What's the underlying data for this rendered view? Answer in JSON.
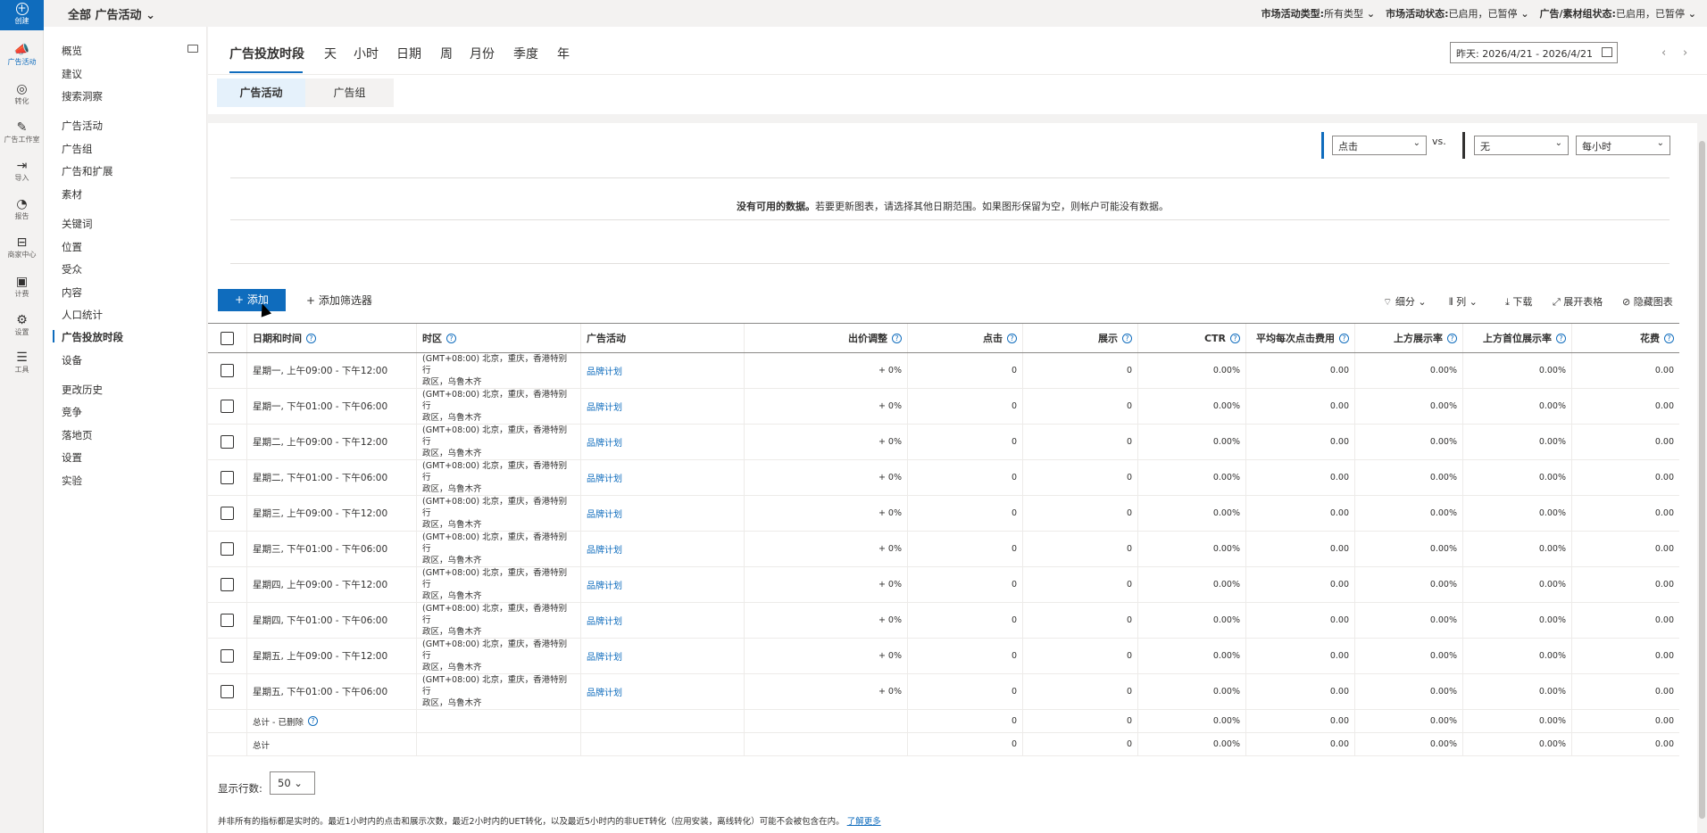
{
  "rail": {
    "create": "创建",
    "items": [
      {
        "label": "广告活动",
        "icon": "megaphone-icon",
        "glyph": "📣"
      },
      {
        "label": "转化",
        "icon": "target-icon",
        "glyph": "◎"
      },
      {
        "label": "广告工作室",
        "icon": "image-edit-icon",
        "glyph": "✎"
      },
      {
        "label": "导入",
        "icon": "import-icon",
        "glyph": "⇥"
      },
      {
        "label": "报告",
        "icon": "report-icon",
        "glyph": "◔"
      },
      {
        "label": "商家中心",
        "icon": "shopping-bag-icon",
        "glyph": "⊟"
      },
      {
        "label": "计费",
        "icon": "wallet-icon",
        "glyph": "▣"
      },
      {
        "label": "设置",
        "icon": "gear-icon",
        "glyph": "⚙"
      },
      {
        "label": "工具",
        "icon": "tools-icon",
        "glyph": "☰"
      }
    ]
  },
  "nav": {
    "items": [
      "概览",
      "建议",
      "搜索洞察",
      "广告活动",
      "广告组",
      "广告和扩展",
      "素材",
      "关键词",
      "位置",
      "受众",
      "内容",
      "人口统计",
      "广告投放时段",
      "设备",
      "更改历史",
      "竞争",
      "落地页",
      "设置",
      "实验"
    ]
  },
  "topbar": {
    "scope": "全部 广告活动",
    "filter1_label": "市场活动类型:",
    "filter1_value": "所有类型",
    "filter2_label": "市场活动状态:",
    "filter2_value": "已启用，已暂停",
    "filter3_label": "广告/素材组状态:",
    "filter3_value": "已启用，已暂停"
  },
  "time_tabs": [
    "广告投放时段",
    "天",
    "小时",
    "日期",
    "周",
    "月份",
    "季度",
    "年"
  ],
  "date_range": "昨天: 2026/4/21 - 2026/4/21",
  "sub_tabs": [
    "广告活动",
    "广告组"
  ],
  "chart": {
    "metric1": "点击",
    "vs": "vs.",
    "metric2": "无",
    "granularity": "每小时",
    "nodata_bold": "没有可用的数据。",
    "nodata_rest": "若要更新图表，请选择其他日期范围。如果图形保留为空，则帐户可能没有数据。"
  },
  "toolbar": {
    "add": "添加",
    "add_filter": "添加筛选器",
    "segment": "细分",
    "columns": "列",
    "download": "下载",
    "expand": "展开表格",
    "hide_chart": "隐藏图表"
  },
  "table": {
    "headers": [
      "日期和时间",
      "时区",
      "广告活动",
      "出价调整",
      "点击",
      "展示",
      "CTR",
      "平均每次点击费用",
      "上方展示率",
      "上方首位展示率",
      "花费"
    ],
    "tz_line1": "(GMT+08:00) 北京，重庆，香港特别行",
    "tz_line2": "政区，乌鲁木齐",
    "campaign": "品牌计划",
    "rows": [
      {
        "time": "星期一, 上午09:00 - 下午12:00",
        "bid": "+ 0%",
        "clicks": "0",
        "impr": "0",
        "ctr": "0.00%",
        "cpc": "0.00",
        "top": "0.00%",
        "abs": "0.00%",
        "spend": "0.00"
      },
      {
        "time": "星期一, 下午01:00 - 下午06:00",
        "bid": "+ 0%",
        "clicks": "0",
        "impr": "0",
        "ctr": "0.00%",
        "cpc": "0.00",
        "top": "0.00%",
        "abs": "0.00%",
        "spend": "0.00"
      },
      {
        "time": "星期二, 上午09:00 - 下午12:00",
        "bid": "+ 0%",
        "clicks": "0",
        "impr": "0",
        "ctr": "0.00%",
        "cpc": "0.00",
        "top": "0.00%",
        "abs": "0.00%",
        "spend": "0.00"
      },
      {
        "time": "星期二, 下午01:00 - 下午06:00",
        "bid": "+ 0%",
        "clicks": "0",
        "impr": "0",
        "ctr": "0.00%",
        "cpc": "0.00",
        "top": "0.00%",
        "abs": "0.00%",
        "spend": "0.00"
      },
      {
        "time": "星期三, 上午09:00 - 下午12:00",
        "bid": "+ 0%",
        "clicks": "0",
        "impr": "0",
        "ctr": "0.00%",
        "cpc": "0.00",
        "top": "0.00%",
        "abs": "0.00%",
        "spend": "0.00"
      },
      {
        "time": "星期三, 下午01:00 - 下午06:00",
        "bid": "+ 0%",
        "clicks": "0",
        "impr": "0",
        "ctr": "0.00%",
        "cpc": "0.00",
        "top": "0.00%",
        "abs": "0.00%",
        "spend": "0.00"
      },
      {
        "time": "星期四, 上午09:00 - 下午12:00",
        "bid": "+ 0%",
        "clicks": "0",
        "impr": "0",
        "ctr": "0.00%",
        "cpc": "0.00",
        "top": "0.00%",
        "abs": "0.00%",
        "spend": "0.00"
      },
      {
        "time": "星期四, 下午01:00 - 下午06:00",
        "bid": "+ 0%",
        "clicks": "0",
        "impr": "0",
        "ctr": "0.00%",
        "cpc": "0.00",
        "top": "0.00%",
        "abs": "0.00%",
        "spend": "0.00"
      },
      {
        "time": "星期五, 上午09:00 - 下午12:00",
        "bid": "+ 0%",
        "clicks": "0",
        "impr": "0",
        "ctr": "0.00%",
        "cpc": "0.00",
        "top": "0.00%",
        "abs": "0.00%",
        "spend": "0.00"
      },
      {
        "time": "星期五, 下午01:00 - 下午06:00",
        "bid": "+ 0%",
        "clicks": "0",
        "impr": "0",
        "ctr": "0.00%",
        "cpc": "0.00",
        "top": "0.00%",
        "abs": "0.00%",
        "spend": "0.00"
      }
    ],
    "totals": [
      {
        "label": "总计 - 已删除",
        "clicks": "0",
        "impr": "0",
        "ctr": "0.00%",
        "cpc": "0.00",
        "top": "0.00%",
        "abs": "0.00%",
        "spend": "0.00"
      },
      {
        "label": "总计",
        "clicks": "0",
        "impr": "0",
        "ctr": "0.00%",
        "cpc": "0.00",
        "top": "0.00%",
        "abs": "0.00%",
        "spend": "0.00"
      }
    ]
  },
  "footer": {
    "rows_label": "显示行数:",
    "rows_value": "50",
    "note": "并非所有的指标都是实时的。最近1小时内的点击和展示次数，最近2小时内的UET转化，以及最近5小时内的非UET转化（应用安装，离线转化）可能不会被包含在内。",
    "learn_more": "了解更多"
  },
  "colors": {
    "accent": "#0f6cbd",
    "metric1": "#0f6cbd",
    "metric2": "#323130"
  }
}
